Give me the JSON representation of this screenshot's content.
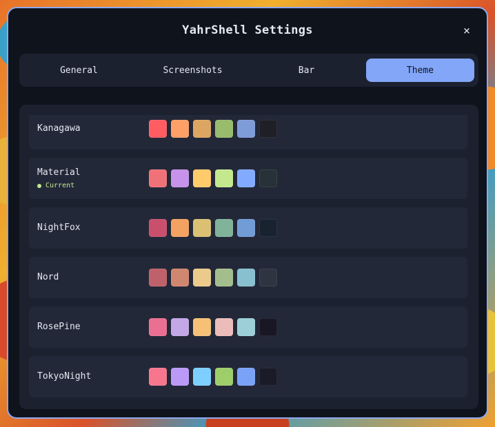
{
  "window": {
    "title": "YahrShell Settings",
    "close_label": "×"
  },
  "tabs": [
    {
      "label": "General",
      "active": false
    },
    {
      "label": "Screenshots",
      "active": false
    },
    {
      "label": "Bar",
      "active": false
    },
    {
      "label": "Theme",
      "active": true
    }
  ],
  "themes": [
    {
      "name": "Kanagawa",
      "current": false,
      "swatches": [
        "#ff5d62",
        "#ffa066",
        "#dca561",
        "#98bb6c",
        "#7e9cd8",
        "#1f1f28"
      ]
    },
    {
      "name": "Material",
      "current": true,
      "current_label": "Current",
      "swatches": [
        "#f07178",
        "#c792ea",
        "#ffcb6b",
        "#c3e88d",
        "#82aaff",
        "#263238"
      ]
    },
    {
      "name": "NightFox",
      "current": false,
      "swatches": [
        "#c94f6d",
        "#f4a261",
        "#dbc074",
        "#81b29a",
        "#719cd6",
        "#192330"
      ]
    },
    {
      "name": "Nord",
      "current": false,
      "swatches": [
        "#bf616a",
        "#d08770",
        "#ebcb8b",
        "#a3be8c",
        "#88c0d0",
        "#2e3440"
      ]
    },
    {
      "name": "RosePine",
      "current": false,
      "swatches": [
        "#eb6f92",
        "#c4a7e7",
        "#f6c177",
        "#ebbcba",
        "#9ccfd8",
        "#191724"
      ]
    },
    {
      "name": "TokyoNight",
      "current": false,
      "swatches": [
        "#f7768e",
        "#bb9af7",
        "#7dcfff",
        "#9ece6a",
        "#7aa2f7",
        "#1a1b26"
      ]
    }
  ],
  "colors": {
    "accent": "#83a6f8",
    "window_bg": "#0f131c",
    "panel_bg": "#1c2130",
    "row_bg": "#232838",
    "current_indicator": "#c3e88d"
  }
}
